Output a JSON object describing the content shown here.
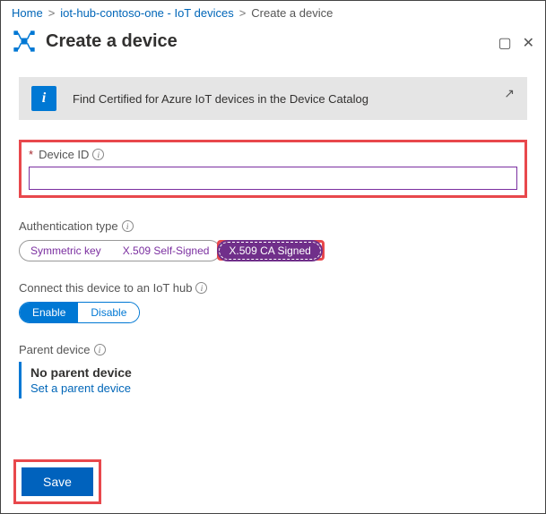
{
  "breadcrumb": {
    "home": "Home",
    "hub": "iot-hub-contoso-one - IoT devices",
    "current": "Create a device"
  },
  "header": {
    "title": "Create a device"
  },
  "banner": {
    "text": "Find Certified for Azure IoT devices in the Device Catalog"
  },
  "deviceId": {
    "label": "Device ID",
    "value": ""
  },
  "auth": {
    "label": "Authentication type",
    "options": {
      "sym": "Symmetric key",
      "self": "X.509 Self-Signed",
      "ca": "X.509 CA Signed"
    },
    "selected": "ca"
  },
  "connect": {
    "label": "Connect this device to an IoT hub",
    "enable": "Enable",
    "disable": "Disable",
    "value": "enable"
  },
  "parent": {
    "label": "Parent device",
    "none": "No parent device",
    "setLink": "Set a parent device"
  },
  "footer": {
    "save": "Save"
  }
}
